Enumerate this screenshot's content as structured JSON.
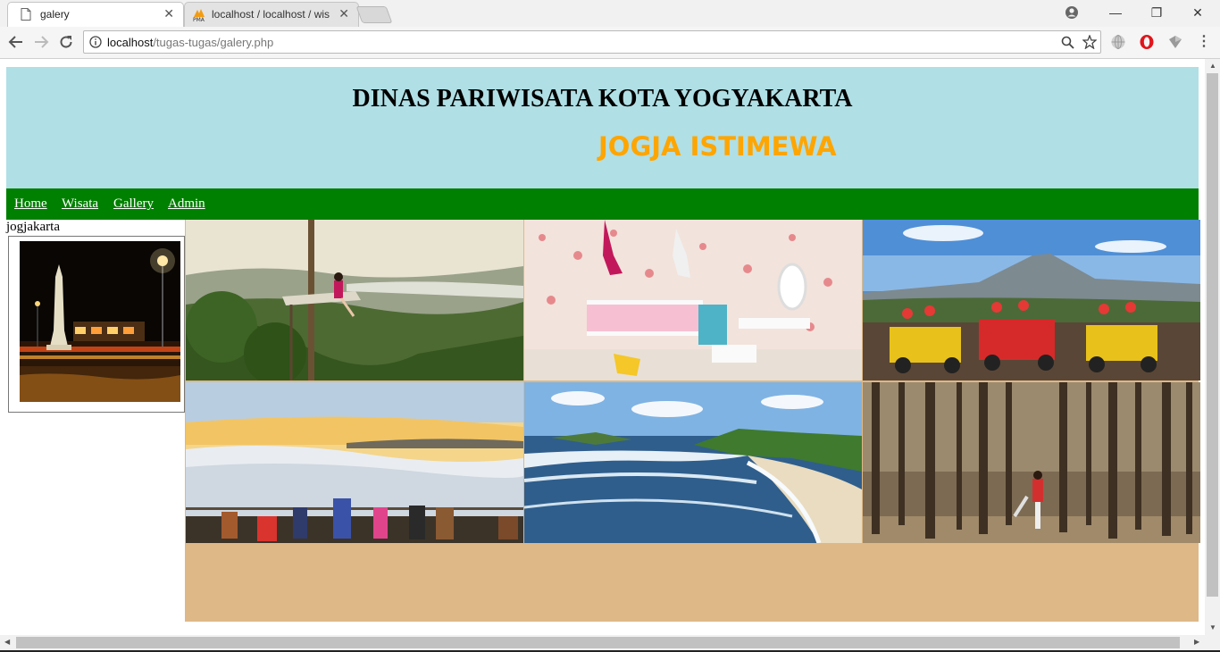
{
  "browser": {
    "tabs": [
      {
        "title": "galery",
        "icon": "page-icon",
        "active": true
      },
      {
        "title": "localhost / localhost / wis",
        "icon": "phpmyadmin-icon",
        "active": false
      }
    ],
    "url_host": "localhost",
    "url_path": "/tugas-tugas/galery.php",
    "close_glyph": "✕",
    "window_controls": {
      "minimize": "—",
      "restore": "❐",
      "close": "✕"
    }
  },
  "header": {
    "title": "DINAS PARIWISATA KOTA YOGYAKARTA",
    "subtitle": "JOGJA ISTIMEWA"
  },
  "nav": [
    "Home",
    "Wisata",
    "Gallery",
    "Admin"
  ],
  "sidebar": {
    "label": "jogjakarta",
    "image": "tugu-jogja-night"
  },
  "gallery": [
    {
      "image": "treehouse-viewpoint"
    },
    {
      "image": "upside-down-house"
    },
    {
      "image": "merapi-jeep-tour"
    },
    {
      "image": "sunrise-clouds-viewpoint"
    },
    {
      "image": "beach-coastline"
    },
    {
      "image": "pine-forest"
    }
  ],
  "colors": {
    "header_bg": "#b0dfe5",
    "subtitle": "#ffa500",
    "navbar_bg": "#008000",
    "gallery_bg": "#deb887"
  }
}
